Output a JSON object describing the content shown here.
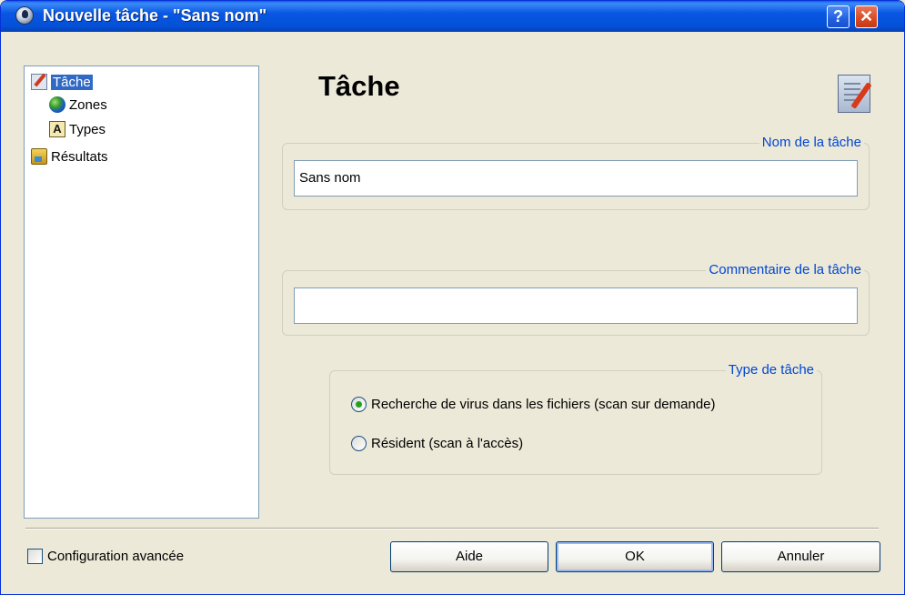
{
  "window": {
    "title": "Nouvelle tâche - \"Sans nom\"",
    "help_glyph": "?",
    "close_glyph": "✕"
  },
  "tree": {
    "items": [
      {
        "label": "Tâche",
        "icon": "task-icon",
        "selected": true
      },
      {
        "label": "Zones",
        "icon": "globe-icon"
      },
      {
        "label": "Types",
        "icon": "types-icon",
        "icon_text": "A"
      },
      {
        "label": "Résultats",
        "icon": "results-icon"
      }
    ]
  },
  "main": {
    "title": "Tâche",
    "task_name": {
      "legend": "Nom de la tâche",
      "value": "Sans nom"
    },
    "task_comment": {
      "legend": "Commentaire de la tâche",
      "value": ""
    },
    "task_type": {
      "legend": "Type de tâche",
      "options": [
        {
          "label": "Recherche de virus dans les fichiers (scan sur demande)",
          "checked": true
        },
        {
          "label": "Résident (scan à l'accès)",
          "checked": false
        }
      ]
    }
  },
  "footer": {
    "advanced_config_label": "Configuration avancée",
    "advanced_config_checked": false,
    "help_button": "Aide",
    "ok_button": "OK",
    "cancel_button": "Annuler"
  },
  "colors": {
    "titlebar": "#0857e3",
    "legend_text": "#0046d5",
    "selection": "#316ac5",
    "radio_dot": "#21a121"
  }
}
